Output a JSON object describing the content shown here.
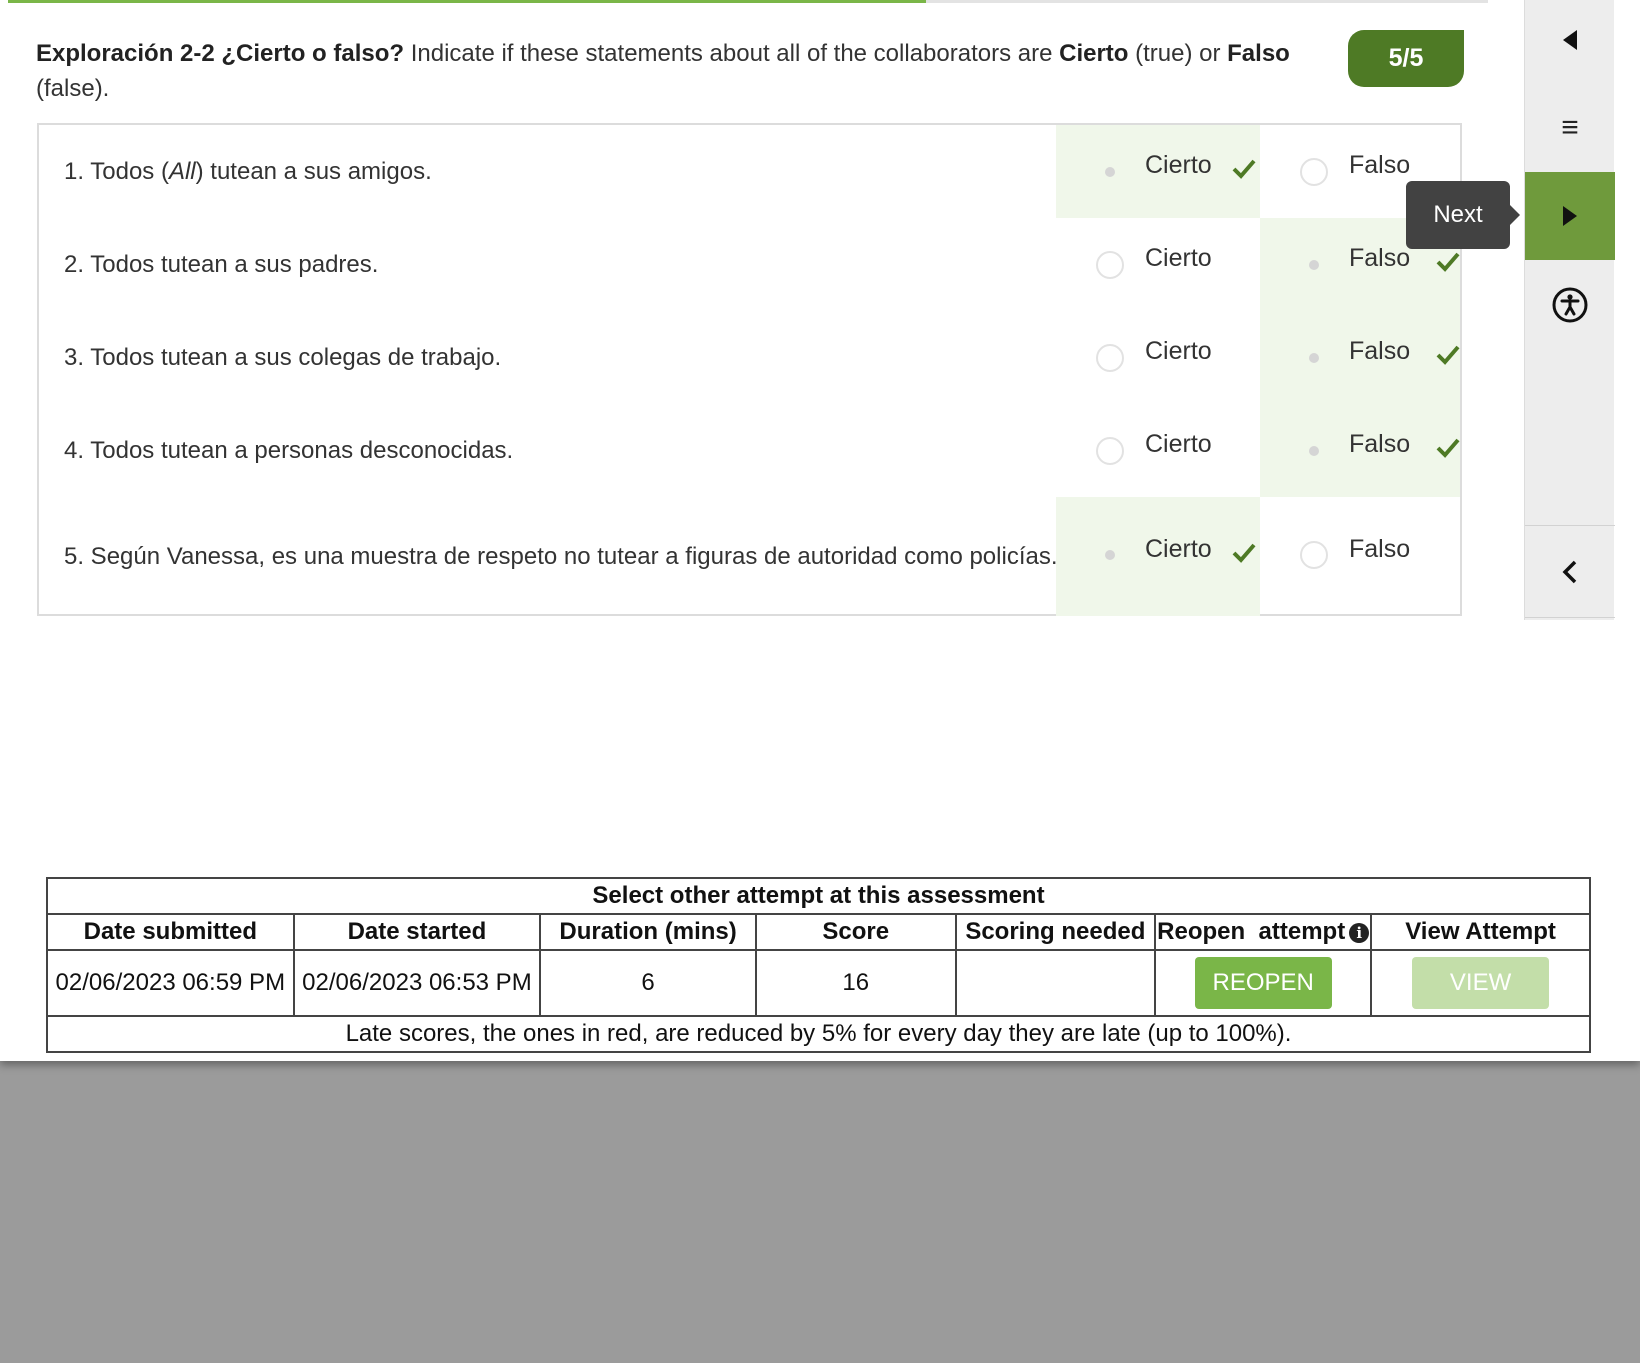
{
  "progress": {
    "fraction": 0.62
  },
  "instructions": {
    "title": "Exploración 2-2 ¿Cierto o falso?",
    "text_1": " Indicate if these statements about all of the collaborators are ",
    "cierto": "Cierto",
    "text_2": " (true) or ",
    "falso": "Falso",
    "text_3": " (false)."
  },
  "score_badge": "5/5",
  "questions": [
    {
      "pre": "1. Todos (",
      "em": "All",
      "post": ") tutean a sus amigos.",
      "answer": "cierto"
    },
    {
      "text": "2. Todos tutean a sus padres.",
      "answer": "falso"
    },
    {
      "text": "3. Todos tutean a sus colegas de trabajo.",
      "answer": "falso"
    },
    {
      "text": "4. Todos tutean a personas desconocidas.",
      "answer": "falso"
    },
    {
      "text": "5. Según Vanessa, es una muestra de respeto no tutear a figuras de autoridad como policías.",
      "answer": "cierto"
    }
  ],
  "options": {
    "cierto": "Cierto",
    "falso": "Falso"
  },
  "tooltip": "Next",
  "rail": {
    "menu_glyph": "≡"
  },
  "attempts": {
    "caption": "Select other attempt at this assessment",
    "headers": [
      "Date submitted",
      "Date started",
      "Duration (mins)",
      "Score",
      "Scoring needed",
      "Reopen  attempt",
      "View Attempt"
    ],
    "row": {
      "date_submitted": "02/06/2023 06:59 PM",
      "date_started": "02/06/2023 06:53 PM",
      "duration": "6",
      "score": "16",
      "scoring_needed": "",
      "reopen_label": "REOPEN",
      "view_label": "VIEW"
    },
    "note": "Late scores, the ones in red, are reduced by 5% for every day they are late (up to 100%)."
  },
  "colors": {
    "accent_green": "#7ab648",
    "badge_green": "#4e7a25",
    "check_green": "#4e7a25",
    "selected_bg": "#f0f7ea",
    "tooltip_bg": "#424242",
    "backdrop": "#9b9b9b"
  }
}
